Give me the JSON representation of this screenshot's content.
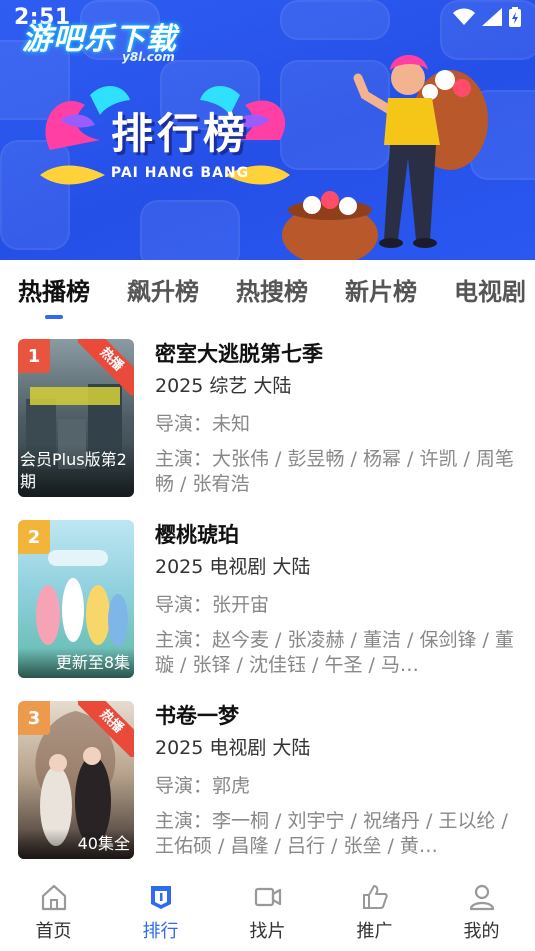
{
  "status_bar": {
    "time": "2:51",
    "icons": [
      "wifi-icon",
      "signal-icon",
      "battery-charging-icon"
    ]
  },
  "watermark": {
    "main": "游吧乐下载",
    "sub": "y8l.com"
  },
  "banner": {
    "title": "排行榜",
    "subtitle": "PAI HANG BANG",
    "colors": {
      "background": "#2a56ee",
      "shirt": "#f5c518",
      "pants": "#2b2f45",
      "bag": "#b8582b"
    }
  },
  "tabs": [
    {
      "label": "热播榜",
      "active": true
    },
    {
      "label": "飙升榜",
      "active": false
    },
    {
      "label": "热搜榜",
      "active": false
    },
    {
      "label": "新片榜",
      "active": false
    },
    {
      "label": "电视剧",
      "active": false
    }
  ],
  "items": [
    {
      "rank": "1",
      "rank_color": "#e9543e",
      "hot_badge": "热播",
      "poster_caption": "会员Plus版第2期",
      "poster_colors": [
        "#6b7c86",
        "#2d3a3f"
      ],
      "title": "密室大逃脱第七季",
      "meta": "2025  综艺  大陆",
      "director": "导演：未知",
      "cast": "主演：大张伟 / 彭昱畅 / 杨幂 / 许凯 / 周笔畅 / 张宥浩"
    },
    {
      "rank": "2",
      "rank_color": "#f3b43a",
      "hot_badge": "",
      "poster_caption": "更新至8集",
      "poster_colors": [
        "#9fd7e8",
        "#5fb8a8"
      ],
      "title": "樱桃琥珀",
      "meta": "2025  电视剧  大陆",
      "director": "导演：张开宙",
      "cast": "主演：赵今麦 / 张凌赫 / 董洁 / 保剑锋 / 董璇 / 张铎 / 沈佳钰 / 午圣 / 马…"
    },
    {
      "rank": "3",
      "rank_color": "#ee9a4d",
      "hot_badge": "热播",
      "poster_caption": "40集全",
      "poster_colors": [
        "#d9cbbd",
        "#3a2f2c"
      ],
      "title": "书卷一梦",
      "meta": "2025  电视剧  大陆",
      "director": "导演：郭虎",
      "cast": "主演：李一桐 / 刘宇宁 / 祝绪丹 / 王以纶 / 王佑硕 / 昌隆 / 吕行 / 张垒 / 黄…"
    }
  ],
  "bottom_nav": [
    {
      "label": "首页",
      "icon": "home-icon",
      "active": false
    },
    {
      "label": "排行",
      "icon": "ranking-icon",
      "active": true
    },
    {
      "label": "找片",
      "icon": "video-camera-icon",
      "active": false
    },
    {
      "label": "推广",
      "icon": "thumbs-up-icon",
      "active": false
    },
    {
      "label": "我的",
      "icon": "user-icon",
      "active": false
    }
  ],
  "accent_color": "#2e6bf0"
}
